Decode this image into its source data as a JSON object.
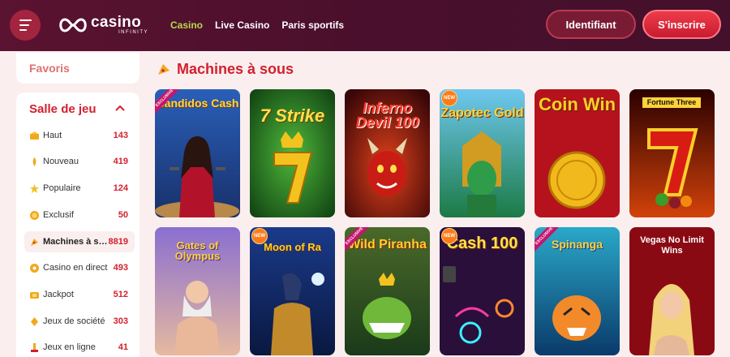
{
  "header": {
    "logo_main": "casino",
    "logo_sub": "INFINITY",
    "nav": [
      "Casino",
      "Live Casino",
      "Paris sportifs"
    ],
    "login_label": "Identifiant",
    "signup_label": "S'inscrire"
  },
  "sidebar": {
    "favorites_label": "Favoris",
    "salle_title": "Salle de jeu",
    "items": [
      {
        "label": "Haut",
        "count": "143",
        "icon": "top-icon"
      },
      {
        "label": "Nouveau",
        "count": "419",
        "icon": "new-icon"
      },
      {
        "label": "Populaire",
        "count": "124",
        "icon": "star-icon"
      },
      {
        "label": "Exclusif",
        "count": "50",
        "icon": "exclusive-icon"
      },
      {
        "label": "Machines à sous",
        "count": "8819",
        "icon": "slot-icon"
      },
      {
        "label": "Casino en direct",
        "count": "493",
        "icon": "live-casino-icon"
      },
      {
        "label": "Jackpot",
        "count": "512",
        "icon": "jackpot-icon"
      },
      {
        "label": "Jeux de société",
        "count": "303",
        "icon": "board-games-icon"
      },
      {
        "label": "Jeux en ligne",
        "count": "41",
        "icon": "online-games-icon"
      }
    ]
  },
  "main": {
    "section_title": "Machines à sous",
    "games": [
      {
        "title": "Bandidos Cash",
        "badge": "EXCLUSIVE"
      },
      {
        "title": "7 Strike",
        "badge": ""
      },
      {
        "title": "Inferno Devil 100",
        "badge": ""
      },
      {
        "title": "Zapotec Gold",
        "badge": "NEW"
      },
      {
        "title": "Coin Win",
        "badge": ""
      },
      {
        "title": "Fortune Three",
        "badge": ""
      },
      {
        "title": "Gates of Olympus",
        "badge": ""
      },
      {
        "title": "Moon of Ra",
        "badge": "NEW"
      },
      {
        "title": "Wild Piranha",
        "badge": "EXCLUSIVE"
      },
      {
        "title": "Cash 100",
        "badge": "NEW"
      },
      {
        "title": "Spinanga",
        "badge": "EXCLUSIVE"
      },
      {
        "title": "Vegas No Limit Wins",
        "badge": ""
      }
    ]
  },
  "colors": {
    "header_bg": "#4a0f2c",
    "accent": "#d3202e",
    "nav_active": "#b9d94a",
    "page_bg": "#fbeeee"
  }
}
